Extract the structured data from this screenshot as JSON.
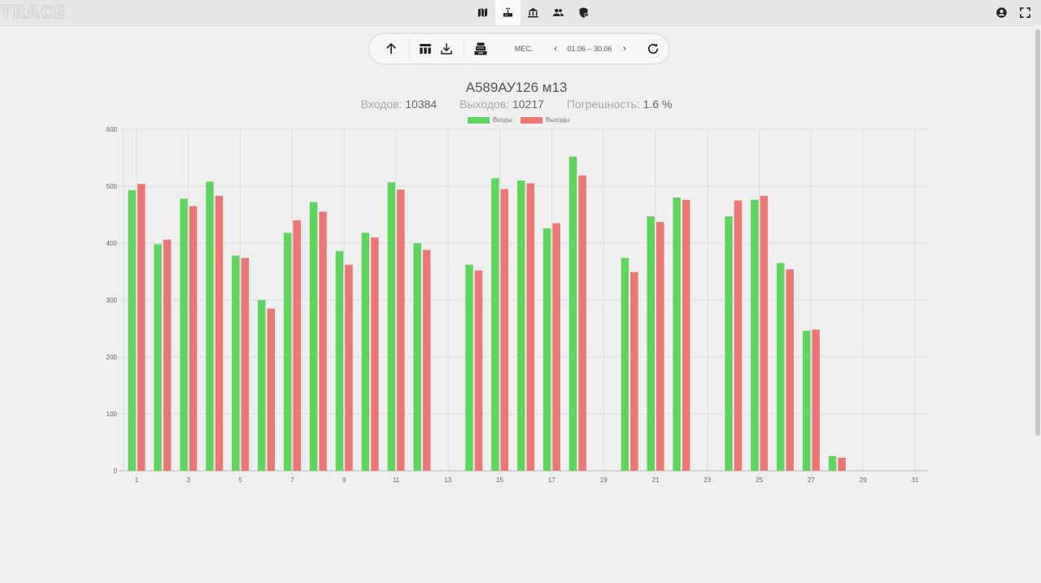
{
  "app": {
    "logo_text": "TRACE"
  },
  "nav": {
    "items": [
      {
        "icon": "map-icon",
        "active": false
      },
      {
        "icon": "router-icon",
        "active": true
      },
      {
        "icon": "bank-icon",
        "active": false
      },
      {
        "icon": "people-icon",
        "active": false
      },
      {
        "icon": "shield-lock-icon",
        "active": false
      }
    ]
  },
  "header_right": {
    "icons": [
      "account-icon",
      "fullscreen-icon"
    ]
  },
  "toolbar": {
    "period": "МЕС.",
    "date_range": "01.06 – 30.06",
    "prev": "‹",
    "next": "›"
  },
  "report": {
    "title": "А589АУ126 м13",
    "inputs_label": "Входов:",
    "inputs_value": "10384",
    "outputs_label": "Выходов:",
    "outputs_value": "10217",
    "error_label": "Погрешность:",
    "error_value": "1.6 %"
  },
  "colors": {
    "inputs": "#5cd65c",
    "outputs": "#f07474",
    "grid": "#dcdcdc",
    "axis": "#bdbdbd"
  },
  "chart_data": {
    "type": "bar",
    "categories": [
      "1",
      "2",
      "3",
      "4",
      "5",
      "6",
      "7",
      "8",
      "9",
      "10",
      "11",
      "12",
      "13",
      "14",
      "15",
      "16",
      "17",
      "18",
      "19",
      "20",
      "21",
      "22",
      "23",
      "24",
      "25",
      "26",
      "27",
      "28",
      "29",
      "30",
      "31"
    ],
    "x_tick_labels": [
      "1",
      "3",
      "5",
      "7",
      "9",
      "11",
      "13",
      "15",
      "17",
      "19",
      "21",
      "23",
      "25",
      "27",
      "29",
      "31"
    ],
    "y_ticks": [
      0,
      100,
      200,
      300,
      400,
      500,
      600
    ],
    "ylim": [
      0,
      600
    ],
    "grid": true,
    "legend": "top-center",
    "series": [
      {
        "name": "Входы",
        "values": [
          493,
          398,
          478,
          508,
          378,
          300,
          418,
          472,
          386,
          418,
          507,
          400,
          0,
          362,
          514,
          510,
          426,
          552,
          0,
          374,
          447,
          480,
          0,
          447,
          476,
          365,
          246,
          26,
          0,
          0,
          0
        ]
      },
      {
        "name": "Выходы",
        "values": [
          504,
          406,
          465,
          483,
          374,
          285,
          440,
          455,
          362,
          410,
          494,
          388,
          0,
          352,
          495,
          505,
          435,
          519,
          0,
          349,
          437,
          476,
          0,
          475,
          483,
          354,
          248,
          23,
          0,
          0,
          0
        ]
      }
    ]
  }
}
